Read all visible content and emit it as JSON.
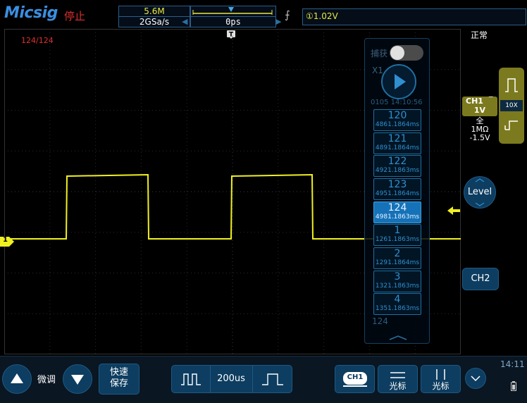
{
  "header": {
    "logo": "Micsig",
    "run_state": "停止",
    "memory_depth": "5.6M",
    "sample_rate": "2GSa/s",
    "trigger_position": "0ps",
    "trigger_slope_symbol": "⨍",
    "trigger_level": "①1.02V"
  },
  "screen": {
    "segment_counter": "124/124",
    "ch1_marker": "1"
  },
  "segments": {
    "capture_label": "捕获",
    "zoom_label": "X1",
    "datetime": "0105 14:10:56",
    "items": [
      {
        "num": "120",
        "time": "4861.1864ms",
        "selected": false
      },
      {
        "num": "121",
        "time": "4891.1864ms",
        "selected": false
      },
      {
        "num": "122",
        "time": "4921.1863ms",
        "selected": false
      },
      {
        "num": "123",
        "time": "4951.1864ms",
        "selected": false
      },
      {
        "num": "124",
        "time": "4981.1863ms",
        "selected": true
      },
      {
        "num": "1",
        "time": "1261.1863ms",
        "selected": false
      },
      {
        "num": "2",
        "time": "1291.1864ms",
        "selected": false
      },
      {
        "num": "3",
        "time": "1321.1863ms",
        "selected": false
      },
      {
        "num": "4",
        "time": "1351.1863ms",
        "selected": false
      }
    ],
    "footer_count": "124"
  },
  "right_panel": {
    "trigger_mode": "正常",
    "ch1_label": "CH1",
    "ch1_scale": "1V",
    "probe": "10X",
    "bandwidth": "全",
    "impedance": "1MΩ",
    "offset": "-1.5V",
    "level_label": "Level",
    "ch2_label": "CH2"
  },
  "bottom": {
    "fine_adjust": "微调",
    "quick_save_line1": "快速",
    "quick_save_line2": "保存",
    "timebase": "200us",
    "ch1_button": "CH1",
    "cursor_h_label": "光标",
    "cursor_v_label": "光标",
    "clock": "14:11"
  },
  "colors": {
    "ch1": "#f0f020",
    "brand": "#3a8fe0",
    "stopped": "#e03030",
    "panel_blue": "#0d3d60",
    "ch1_badge": "#7c7a1e"
  }
}
